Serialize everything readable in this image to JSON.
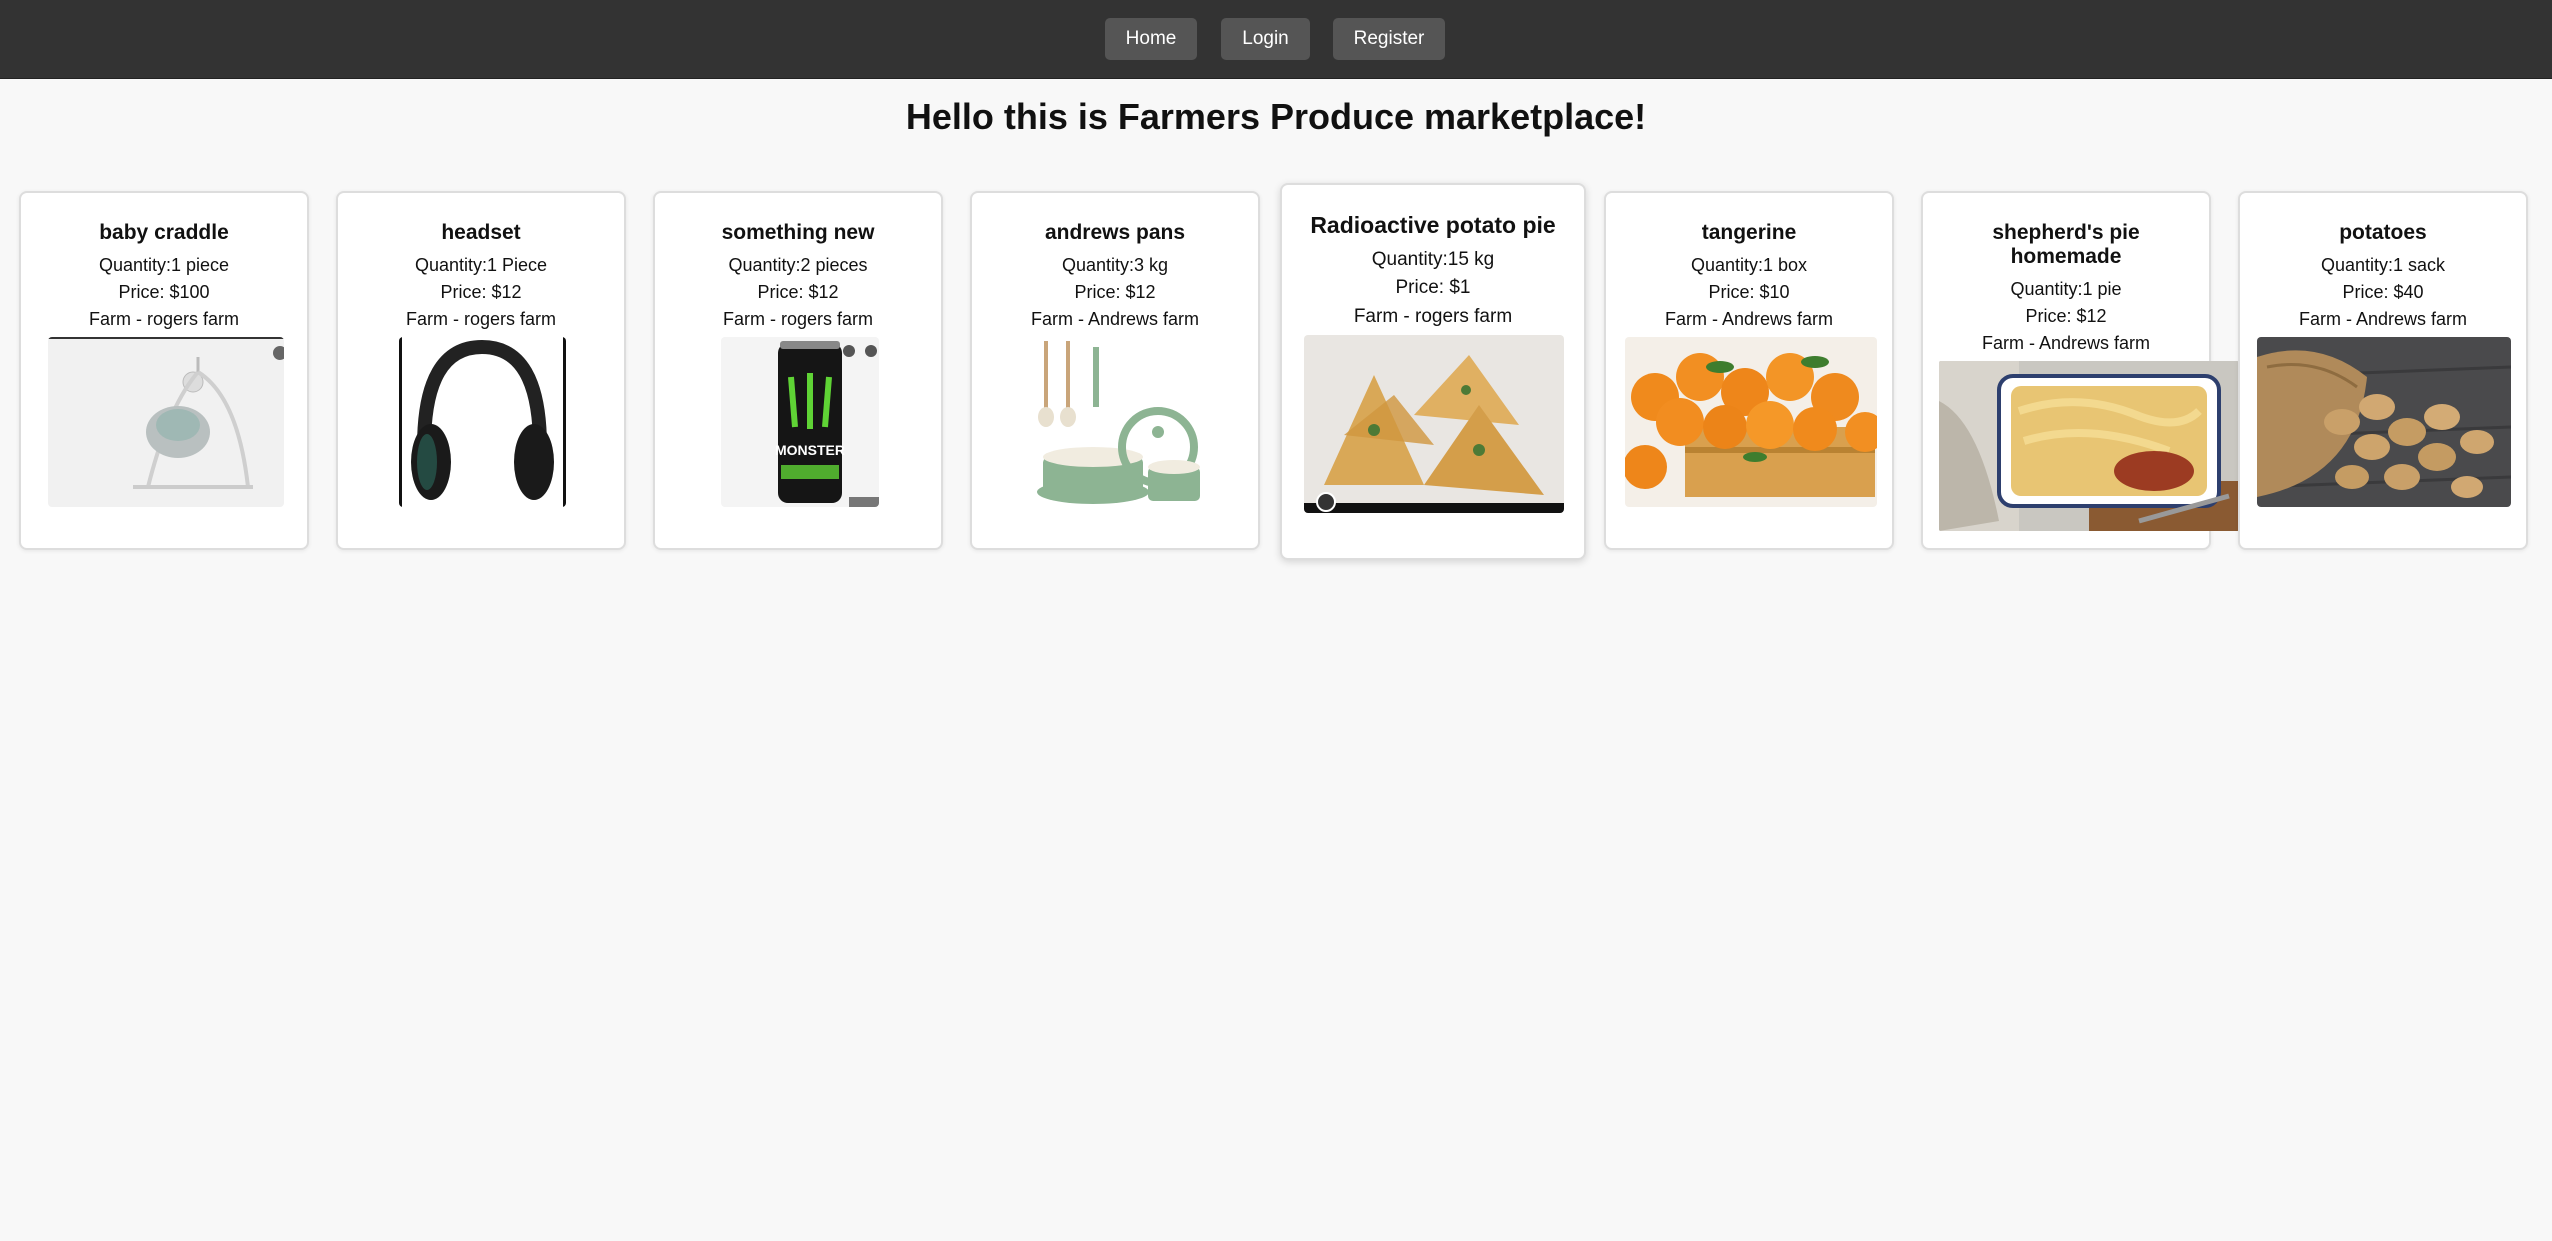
{
  "nav": {
    "home": "Home",
    "login": "Login",
    "register": "Register"
  },
  "page": {
    "title": "Hello this is Farmers Produce marketplace!"
  },
  "products": [
    {
      "name": "baby craddle",
      "quantity": "Quantity:1 piece",
      "price": "Price: $100",
      "farm": "Farm - rogers farm"
    },
    {
      "name": "headset",
      "quantity": "Quantity:1 Piece",
      "price": "Price: $12",
      "farm": "Farm - rogers farm"
    },
    {
      "name": "something new",
      "quantity": "Quantity:2 pieces",
      "price": "Price: $12",
      "farm": "Farm - rogers farm",
      "image_text": "MONSTER"
    },
    {
      "name": "andrews pans",
      "quantity": "Quantity:3 kg",
      "price": "Price: $12",
      "farm": "Farm - Andrews farm"
    },
    {
      "name": "Radioactive potato pie",
      "quantity": "Quantity:15 kg",
      "price": "Price: $1",
      "farm": "Farm - rogers farm"
    },
    {
      "name": "tangerine",
      "quantity": "Quantity:1 box",
      "price": "Price: $10",
      "farm": "Farm - Andrews farm"
    },
    {
      "name": "shepherd's pie homemade",
      "quantity": "Quantity:1 pie",
      "price": "Price: $12",
      "farm": "Farm - Andrews farm"
    },
    {
      "name": "potatoes",
      "quantity": "Quantity:1 sack",
      "price": "Price: $40",
      "farm": "Farm - Andrews farm"
    }
  ],
  "colors": {
    "navbar": "#333333",
    "nav_button": "#555555",
    "page_background": "#f8f8f8",
    "card_border": "#dddddd"
  }
}
